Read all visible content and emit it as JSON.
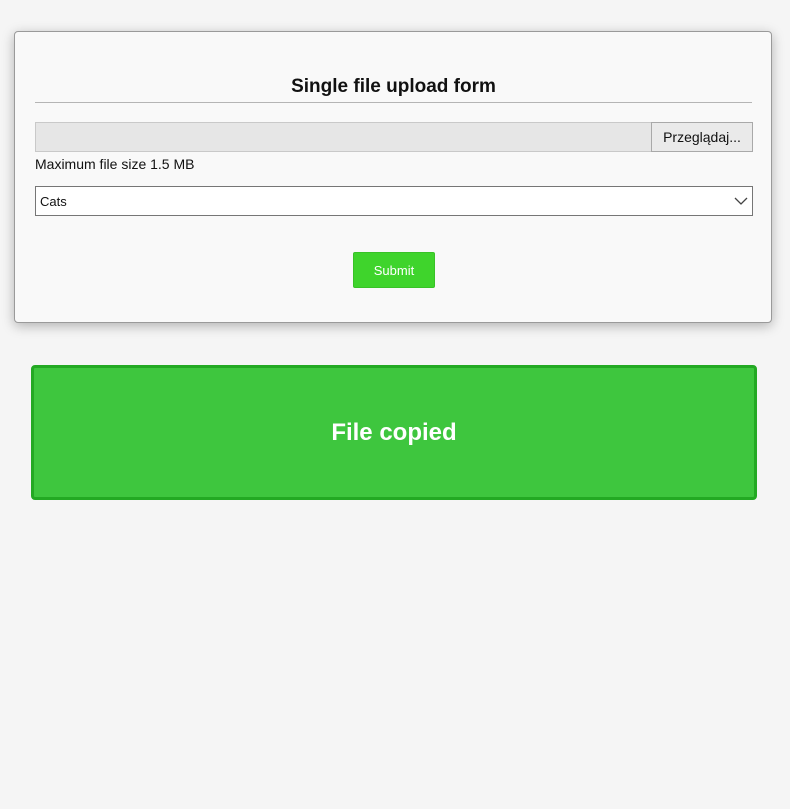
{
  "form": {
    "title": "Single file upload form",
    "browse_label": "Przeglądaj...",
    "file_name": "",
    "size_note": "Maximum file size 1.5 MB",
    "category_selected": "Cats",
    "submit_label": "Submit"
  },
  "message": {
    "text": "File copied"
  },
  "colors": {
    "page_background": "#f5f5f5",
    "card_background": "#f9f9f9",
    "submit_green": "#3fd42c",
    "banner_green": "#3ec63e",
    "banner_border": "#23a923"
  },
  "icons": {
    "select_arrow": "chevron-down-icon"
  }
}
